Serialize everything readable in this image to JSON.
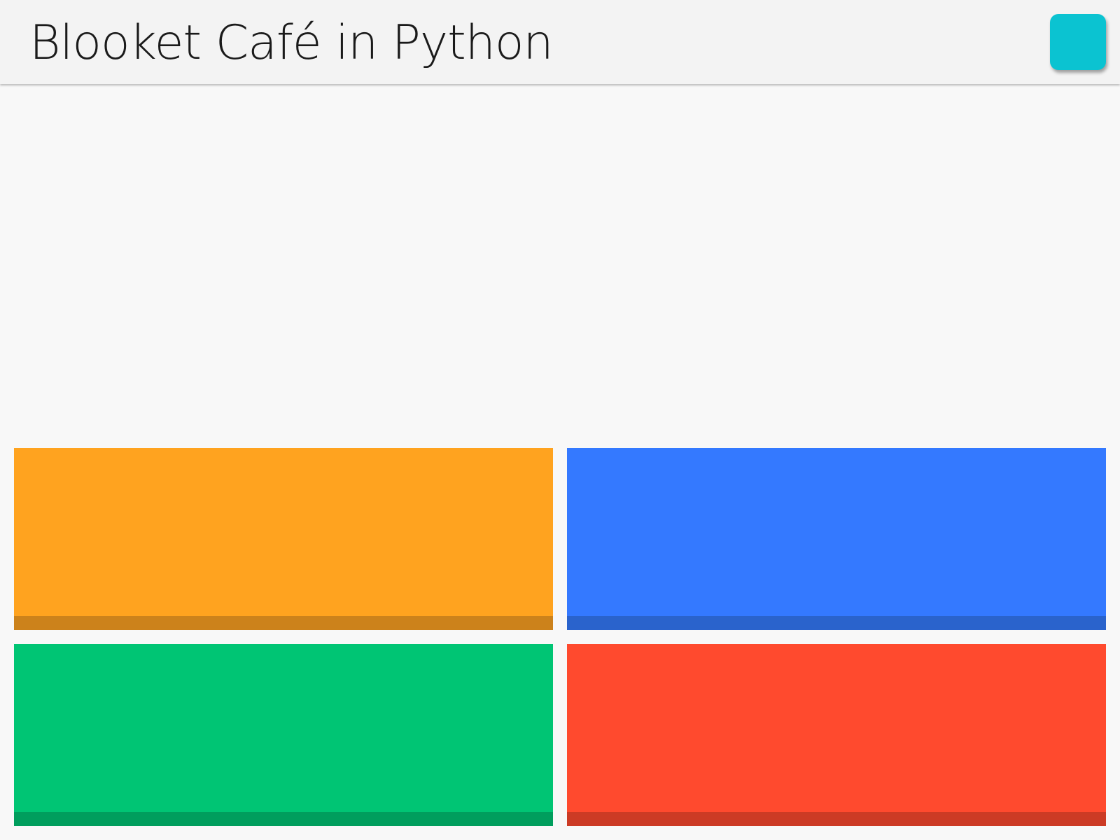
{
  "header": {
    "title": "Blooket Café in Python",
    "corner_button_color": "#0bc3d1"
  },
  "question": {
    "text": ""
  },
  "answers": [
    {
      "label": "",
      "color": "#ffa31f",
      "edge_color": "#cc821b"
    },
    {
      "label": "",
      "color": "#3479ff",
      "edge_color": "#2a63cc"
    },
    {
      "label": "",
      "color": "#00c574",
      "edge_color": "#009e5d"
    },
    {
      "label": "",
      "color": "#ff4a2e",
      "edge_color": "#cc3b25"
    }
  ]
}
